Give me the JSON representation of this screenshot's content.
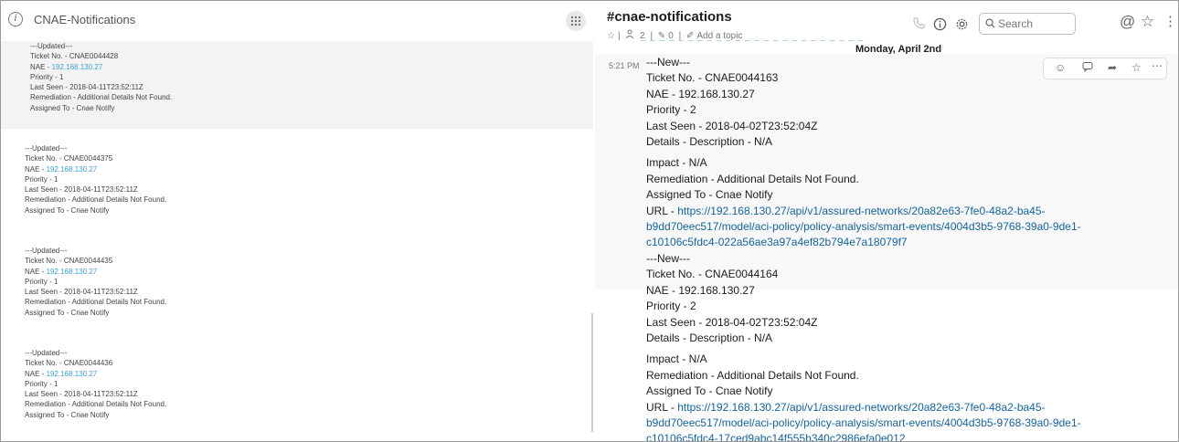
{
  "left": {
    "title": "CNAE-Notifications",
    "tickets": [
      {
        "header": "---Updated---",
        "ticket": "Ticket No. - CNAE0044428",
        "nae_label": "NAE - ",
        "nae_ip": "192.168.130.27",
        "priority": "Priority - 1",
        "last_seen": "Last Seen - 2018-04-11T23:52:11Z",
        "remediation": "Remediation - Additional Details Not Found.",
        "assigned": "Assigned To - Cnae Notify"
      },
      {
        "header": "---Updated---",
        "ticket": "Ticket No. - CNAE0044375",
        "nae_label": "NAE - ",
        "nae_ip": "192.168.130.27",
        "priority": "Priority - 1",
        "last_seen": "Last Seen - 2018-04-11T23:52:11Z",
        "remediation": "Remediation - Additional Details Not Found.",
        "assigned": "Assigned To - Cnae Notify"
      },
      {
        "header": "---Updated---",
        "ticket": "Ticket No. - CNAE0044435",
        "nae_label": "NAE - ",
        "nae_ip": "192.168.130.27",
        "priority": "Priority - 1",
        "last_seen": "Last Seen - 2018-04-11T23:52:11Z",
        "remediation": "Remediation - Additional Details Not Found.",
        "assigned": "Assigned To - Cnae Notify"
      },
      {
        "header": "---Updated---",
        "ticket": "Ticket No. - CNAE0044436",
        "nae_label": "NAE - ",
        "nae_ip": "192.168.130.27",
        "priority": "Priority - 1",
        "last_seen": "Last Seen - 2018-04-11T23:52:11Z",
        "remediation": "Remediation - Additional Details Not Found.",
        "assigned": "Assigned To - Cnae Notify"
      }
    ]
  },
  "channel": {
    "name": "#cnae-notifications",
    "members": "2",
    "pins": "0",
    "add_topic": "Add a topic",
    "search_placeholder": "Search"
  },
  "messages": {
    "date_divider": "Monday, April 2nd",
    "time": "5:21 PM",
    "items": [
      {
        "header": "---New---",
        "ticket": "Ticket No. - CNAE0044163",
        "nae": "NAE - 192.168.130.27",
        "priority": "Priority - 2",
        "last_seen": "Last Seen - 2018-04-02T23:52:04Z",
        "details": "Details - Description - N/A",
        "impact": "Impact - N/A",
        "remediation": "Remediation - Additional Details Not Found.",
        "assigned": "Assigned To - Cnae Notify",
        "url_label": "URL - ",
        "url_1": "https://192.168.130.27/api/v1/assured-networks/20a82e63-7fe0-48a2-ba45-",
        "url_2": "b9dd70eec517/model/aci-policy/policy-analysis/smart-events/4004d3b5-9768-39a0-9de1-",
        "url_3": "c10106c5fdc4-022a56ae3a97a4ef82b794e7a18079f7"
      },
      {
        "header": "---New---",
        "ticket": "Ticket No. - CNAE0044164",
        "nae": "NAE - 192.168.130.27",
        "priority": "Priority - 2",
        "last_seen": "Last Seen - 2018-04-02T23:52:04Z",
        "details": "Details - Description - N/A",
        "impact": "Impact - N/A",
        "remediation": "Remediation - Additional Details Not Found.",
        "assigned": "Assigned To - Cnae Notify",
        "url_label": "URL - ",
        "url_1": "https://192.168.130.27/api/v1/assured-networks/20a82e63-7fe0-48a2-ba45-",
        "url_2": "b9dd70eec517/model/aci-policy/policy-analysis/smart-events/4004d3b5-9768-39a0-9de1-",
        "url_3": "c10106c5fdc4-17ced9abc14f555b340c2986efa0e012"
      }
    ]
  },
  "colors": {
    "link": "#1264a3",
    "ip": "#3aa0dc"
  }
}
